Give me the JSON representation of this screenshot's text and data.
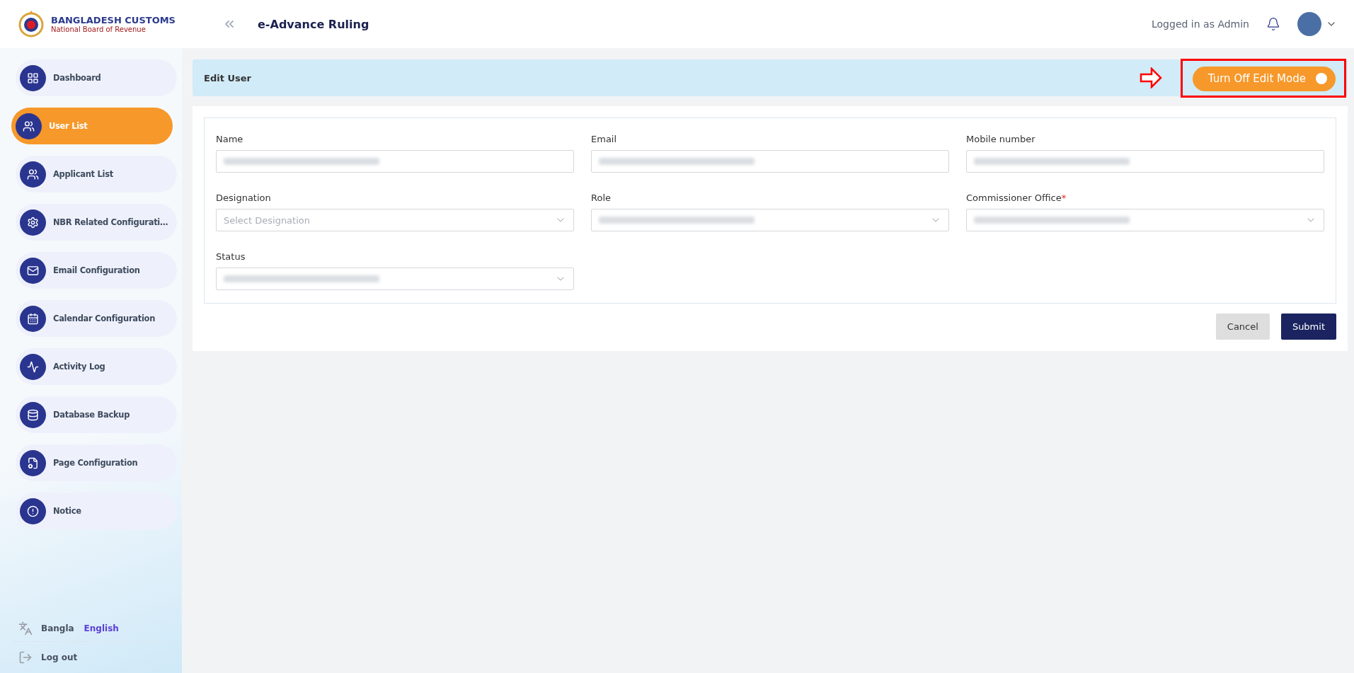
{
  "brand": {
    "name": "BANGLADESH CUSTOMS",
    "subtitle": "National Board of Revenue"
  },
  "header": {
    "title": "e-Advance Ruling",
    "user_label": "Logged in as Admin"
  },
  "sidebar": {
    "items": [
      {
        "label": "Dashboard",
        "selected": false
      },
      {
        "label": "User List",
        "selected": true
      },
      {
        "label": "Applicant List",
        "selected": false
      },
      {
        "label": "NBR Related Configurati…",
        "selected": false
      },
      {
        "label": "Email Configuration",
        "selected": false
      },
      {
        "label": "Calendar Configuration",
        "selected": false
      },
      {
        "label": "Activity Log",
        "selected": false
      },
      {
        "label": "Database Backup",
        "selected": false
      },
      {
        "label": "Page Configuration",
        "selected": false
      },
      {
        "label": "Notice",
        "selected": false
      }
    ],
    "languages": [
      {
        "label": "Bangla",
        "selected": false
      },
      {
        "label": "English",
        "selected": true
      }
    ],
    "logout": "Log out"
  },
  "page": {
    "title": "Edit User",
    "edit_toggle": {
      "label": "Turn Off Edit Mode",
      "on": true
    }
  },
  "form": {
    "fields": [
      {
        "label": "Name",
        "kind": "text"
      },
      {
        "label": "Email",
        "kind": "text"
      },
      {
        "label": "Mobile number",
        "kind": "text"
      },
      {
        "label": "Designation",
        "kind": "select",
        "placeholder": "Select Designation"
      },
      {
        "label": "Role",
        "kind": "select"
      },
      {
        "label": "Commissioner Office",
        "kind": "select",
        "required_mark": "*"
      },
      {
        "label": "Status",
        "kind": "select"
      }
    ],
    "buttons": [
      {
        "label": "Cancel",
        "kind": "secondary"
      },
      {
        "label": "Submit",
        "kind": "primary"
      }
    ]
  }
}
